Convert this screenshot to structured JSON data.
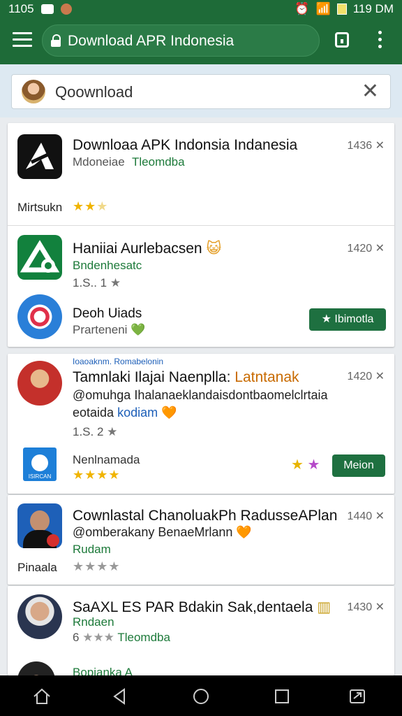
{
  "status": {
    "time_left": "1105",
    "time_right": "119 DM"
  },
  "appbar": {
    "url_title": "Download APR Indonesia"
  },
  "search": {
    "query": "Qoownload"
  },
  "results": [
    {
      "title": "Downloaa APK Indonsia Indanesia",
      "meta": "1436",
      "subtitle_a": "Mdoneiae",
      "subtitle_b": "Tleomdba",
      "footer": "Mirtsukn",
      "rating": "2.5"
    },
    {
      "title": "Haniiai Aurlebacsen",
      "meta": "1420",
      "subtitle_a": "Bndenhesatc",
      "line3": "1.S.. 1",
      "second_title": "Deoh Uiads",
      "second_sub": "Prarteneni",
      "button": "Ibimotla"
    },
    {
      "header_overlay": "Ioaoaknm. Romabelonin",
      "title_a": "Tamnlaki Ilajai Naenplla:",
      "title_b": "Latntanak",
      "line2": "@omuhga Ihalanaeklandaisdontbaomelclrtaia",
      "line3_a": "eotaida",
      "line3_b": "kodiam",
      "meta": "1420",
      "rating_text": "1.S. 2",
      "second_title": "Nenlnamada",
      "second_icon_text": "ISIRCAN",
      "button": "Meion"
    },
    {
      "title": "Cownlastal ChanoluakPh RadusseAPlan",
      "meta": "1440",
      "line2": "@omberakany BenaeMrlann",
      "line3": "Rudam",
      "footer": "Pinaala"
    },
    {
      "title": "SaAXL ES PAR Bdakin Sak,dentaela",
      "meta": "1430",
      "line2": "Rndaen",
      "line3_a": "6",
      "line3_b": "Tleomdba"
    },
    {
      "title": "Bopianka A"
    }
  ],
  "colors": {
    "primary_green": "#1e6b38",
    "star": "#f0b400",
    "accent_green": "#1d7a3a"
  }
}
